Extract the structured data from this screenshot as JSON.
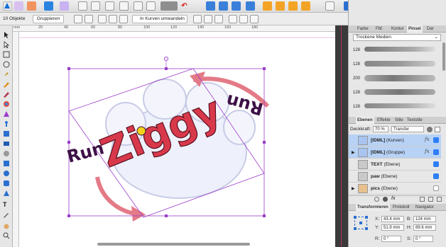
{
  "toolbar": {
    "icons": [
      "persona-designer-icon",
      "persona-pixel-icon",
      "persona-export-icon",
      "snap-icon",
      "transform-icon",
      "align-icon",
      "boolean-icon",
      "arrange-icon",
      "order-icon",
      "insert-icon",
      "flip-icon",
      "rotate-icon",
      "group-icon",
      "zoom-icon",
      "assistant-icon",
      "view-icon"
    ]
  },
  "context": {
    "selection_count": "10 Objekte",
    "group_label": "Gruppieren",
    "convert_label": "In Kurven umwandeln"
  },
  "ruler": {
    "h_labels": [
      "mm",
      "20",
      "40",
      "60",
      "80",
      "100",
      "120",
      "140",
      "160",
      "180"
    ]
  },
  "artwork": {
    "top_text": "Ziggy",
    "left_text": "Run",
    "right_text": "Run",
    "accent_color": "#d8394a",
    "outline_color": "#3d1146",
    "selection_color": "#9b3dcb"
  },
  "brushes": {
    "tabs": [
      "Farbe",
      "Fbf.",
      "Kontur",
      "Pinsel",
      "Dar"
    ],
    "active_tab": "Pinsel",
    "category": "Trockene Medien",
    "sizes": [
      "128",
      "128",
      "200",
      "128",
      "128"
    ]
  },
  "layers": {
    "tabs": [
      "Ebenen",
      "Effekte",
      "Stile",
      "Textstile"
    ],
    "active_tab": "Ebenen",
    "opacity_label": "Deckkraft:",
    "opacity_value": "70 %",
    "blend_mode": "Transfer",
    "items": [
      {
        "name": "[IDML]",
        "kind": "(Kurven)",
        "selected": true,
        "visible": true,
        "fx": true
      },
      {
        "name": "[IDML]",
        "kind": "(Gruppe)",
        "selected": true,
        "visible": true,
        "fx": true
      },
      {
        "name": "TEXT",
        "kind": "(Ebene)",
        "selected": false,
        "visible": true,
        "fx": false
      },
      {
        "name": "paw",
        "kind": "(Ebene)",
        "selected": false,
        "visible": true,
        "fx": false
      },
      {
        "name": "pics",
        "kind": "(Ebene)",
        "selected": false,
        "visible": false,
        "fx": false
      }
    ]
  },
  "transform": {
    "tabs": [
      "Transformieren",
      "Protokoll",
      "Navigator"
    ],
    "active_tab": "Transformieren",
    "x_label": "X:",
    "x_value": "43.4 mm",
    "y_label": "Y:",
    "y_value": "51.9 mm",
    "b_label": "B:",
    "b_value": "124 mm",
    "h_label": "H:",
    "h_value": "89.6 mm",
    "r_label": "R:",
    "r_value": "0 °",
    "s_label": "S:",
    "s_value": "0 °"
  }
}
